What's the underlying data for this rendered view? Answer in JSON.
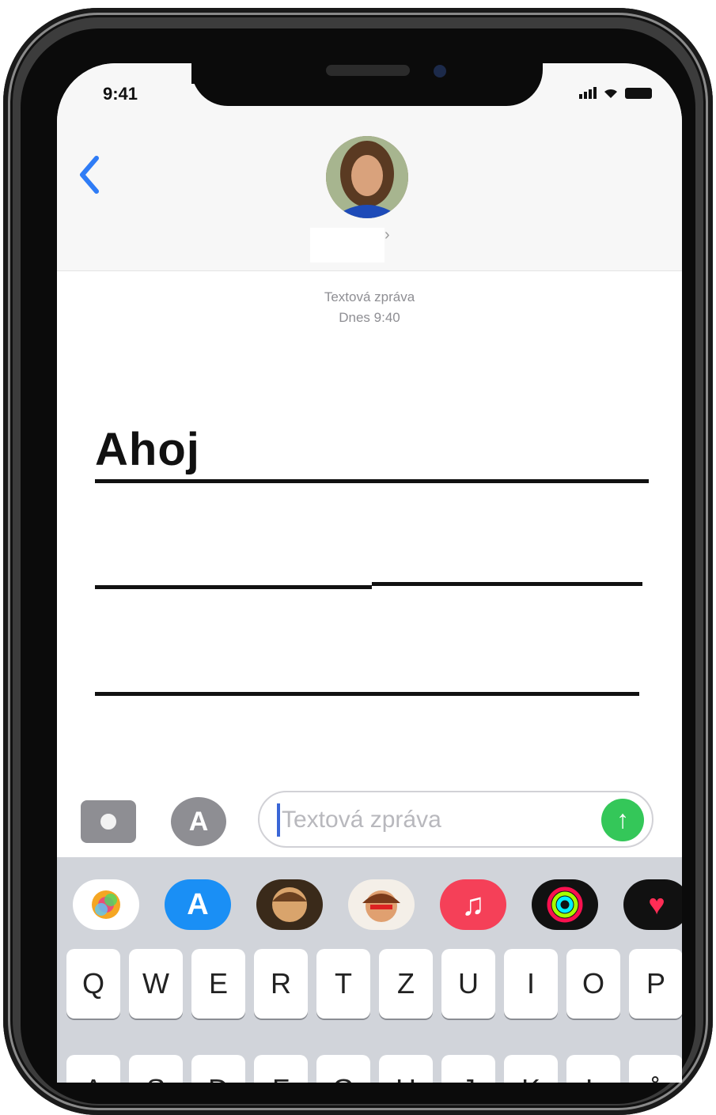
{
  "status_bar": {
    "time": "9:41"
  },
  "messages": {
    "meta_line1": "Textová zpráva",
    "meta_line2": "Dnes 9:40",
    "message_text": "Ahoj"
  },
  "input": {
    "placeholder": "Textová zpráva"
  },
  "app_drawer": {
    "apps": [
      {
        "name": "photos-icon",
        "color": "#ffffff"
      },
      {
        "name": "appstore-icon",
        "color": "#1a8ff5"
      },
      {
        "name": "memoji-icon-1",
        "color": "#3a2a1a"
      },
      {
        "name": "memoji-icon-2",
        "color": "#f4efe8"
      },
      {
        "name": "music-icon",
        "color": "#f54058"
      },
      {
        "name": "activity-icon",
        "color": "#111111"
      },
      {
        "name": "digital-touch-icon",
        "color": "#111111"
      }
    ]
  },
  "keyboard": {
    "row1": [
      "Q",
      "W",
      "E",
      "R",
      "T",
      "Z",
      "U",
      "I",
      "O",
      "P"
    ],
    "row2": [
      "A",
      "S",
      "D",
      "F",
      "G",
      "H",
      "J",
      "K",
      "L",
      "˚"
    ]
  },
  "colors": {
    "accent": "#2f7cf6",
    "send": "#34c759"
  }
}
